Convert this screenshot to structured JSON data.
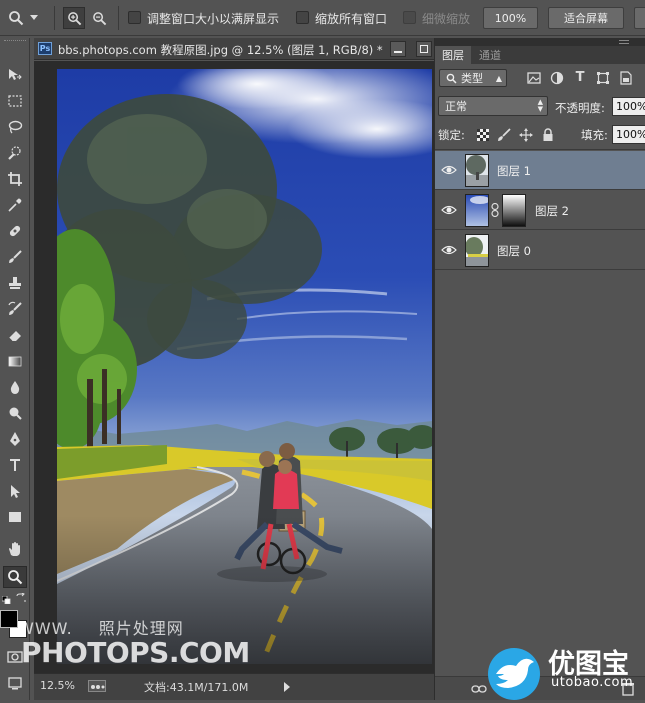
{
  "options_bar": {
    "resize_windows_label": "调整窗口大小以满屏显示",
    "zoom_all_windows_label": "缩放所有窗口",
    "scrubby_zoom_label": "细微缩放",
    "actual_pixels_button": "100%",
    "fit_screen_button": "适合屏幕"
  },
  "document": {
    "tab_title": "bbs.photops.com 教程原图.jpg @ 12.5% (图层 1, RGB/8) *",
    "app_badge": "Ps"
  },
  "status_bar": {
    "zoom": "12.5%",
    "doc_size": "文档:43.1M/171.0M"
  },
  "watermark": {
    "line1": "WWW.",
    "line1_suffix": "照片处理网",
    "line2": "PHOTOPS.COM"
  },
  "panel": {
    "tabs": [
      "图层",
      "通道"
    ],
    "filter_type": "类型",
    "blend_mode": "正常",
    "opacity_label": "不透明度:",
    "opacity_value": "100%",
    "lock_label": "锁定:",
    "fill_label": "填充:",
    "fill_value": "100%",
    "layers": [
      {
        "name": "图层 1",
        "selected": true,
        "has_mask": false
      },
      {
        "name": "图层 2",
        "selected": false,
        "has_mask": true
      },
      {
        "name": "图层 0",
        "selected": false,
        "has_mask": false
      }
    ]
  },
  "logo": {
    "text": "优图宝",
    "url": "utobao.com"
  },
  "colors": {
    "ui_bg": "#535353",
    "selected_layer": "#6f7e91",
    "sky_top": "#1e3ca6",
    "sky_bottom": "#c8d6ea"
  },
  "icons": [
    "zoom-icon",
    "zoom-in-icon",
    "zoom-out-icon",
    "move-icon",
    "marquee-icon",
    "lasso-icon",
    "quick-select-icon",
    "crop-icon",
    "eyedropper-icon",
    "healing-icon",
    "brush-icon",
    "stamp-icon",
    "history-brush-icon",
    "eraser-icon",
    "gradient-icon",
    "blur-icon",
    "dodge-icon",
    "pen-icon",
    "type-icon",
    "path-select-icon",
    "shape-icon",
    "hand-icon",
    "eye-icon",
    "lock-icon",
    "link-icon"
  ]
}
